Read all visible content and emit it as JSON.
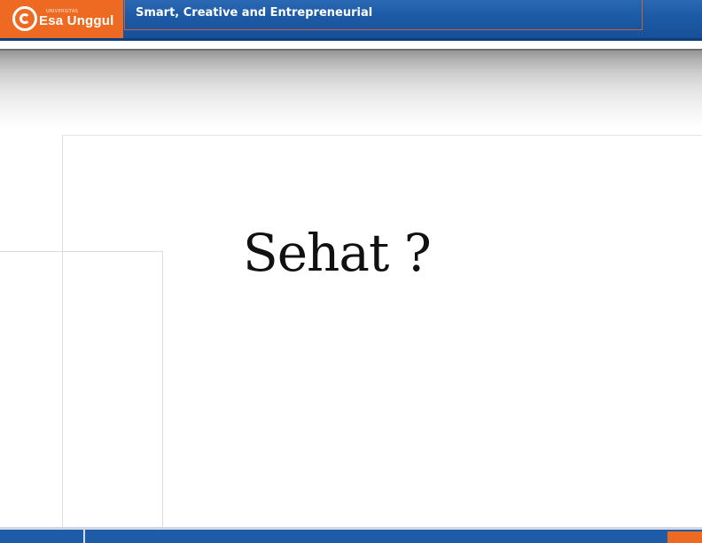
{
  "header": {
    "logo_small_text": "UNIVERSITAS",
    "logo_text": "Esa Unggul",
    "tagline": "Smart, Creative and Entrepreneurial",
    "bar_color": "#1d5aa6",
    "logo_color": "#ee6a22"
  },
  "slide": {
    "title": "Sehat ?"
  },
  "footer": {
    "bar_color": "#1e5ca8",
    "accent_color": "#ee6a22"
  }
}
